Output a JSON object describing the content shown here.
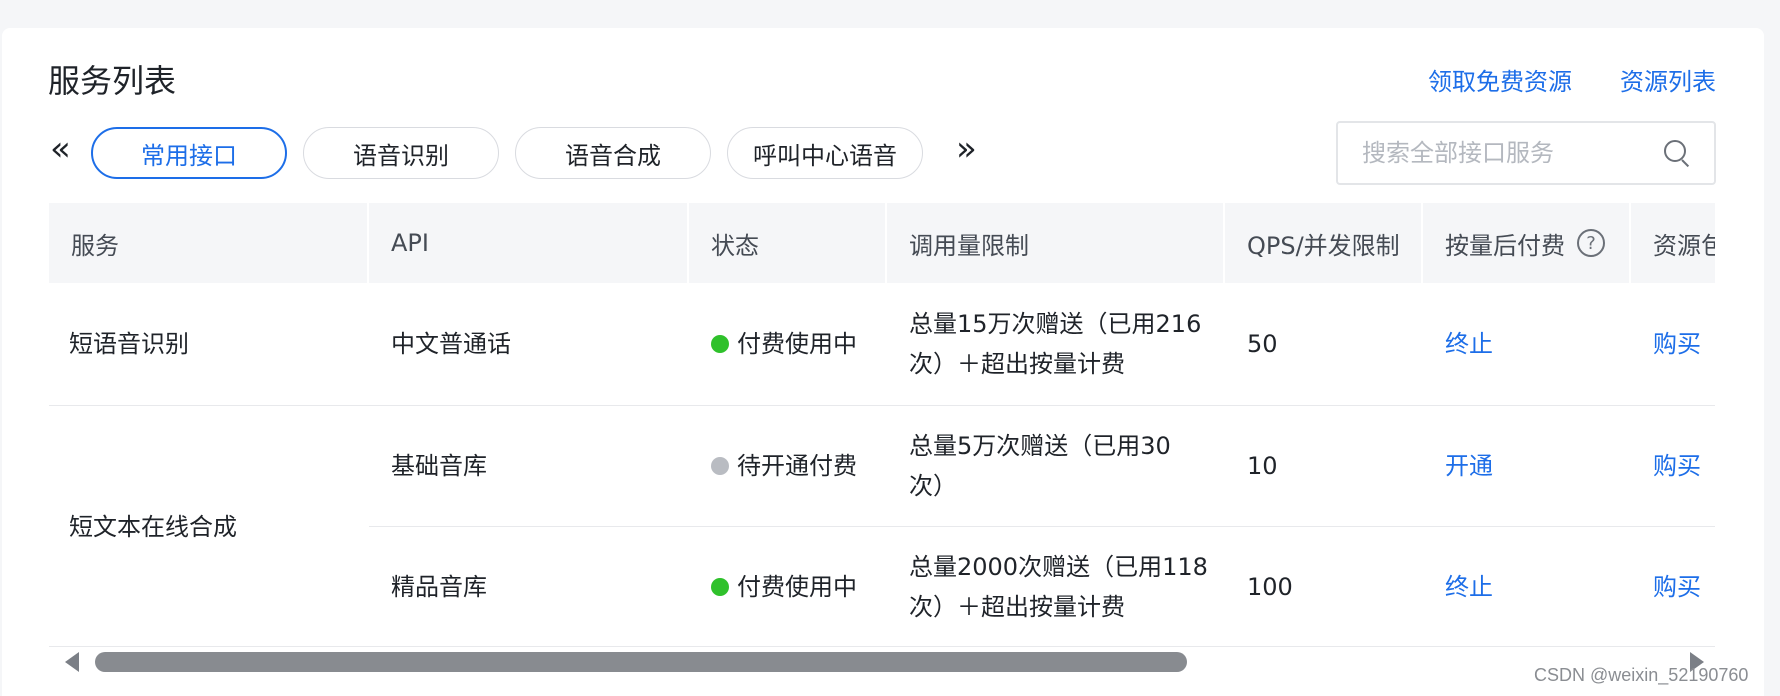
{
  "header": {
    "title": "服务列表",
    "link_free": "领取免费资源",
    "link_resources": "资源列表"
  },
  "nav": {
    "prev_arrow": "«",
    "next_arrow": "»"
  },
  "tabs": [
    {
      "label": "常用接口",
      "active": true
    },
    {
      "label": "语音识别",
      "active": false
    },
    {
      "label": "语音合成",
      "active": false
    },
    {
      "label": "呼叫中心语音",
      "active": false
    }
  ],
  "search": {
    "placeholder": "搜索全部接口服务",
    "value": ""
  },
  "table": {
    "columns": [
      "服务",
      "API",
      "状态",
      "调用量限制",
      "QPS/并发限制",
      "按量后付费",
      "资源包"
    ],
    "help_icon": "?",
    "groups": [
      {
        "service": "短语音识别"
      },
      {
        "service": "短文本在线合成"
      }
    ],
    "rows": [
      {
        "api": "中文普通话",
        "status": "付费使用中",
        "status_color": "#2fc12b",
        "limit_line1": "总量15万次赠送（已用216",
        "limit_line2": "次）＋超出按量计费",
        "qps": "50",
        "postpaid": "终止",
        "package": "购买"
      },
      {
        "api": "基础音库",
        "status": "待开通付费",
        "status_color": "#b9bcc2",
        "limit_line1": "总量5万次赠送（已用30",
        "limit_line2": "次）",
        "qps": "10",
        "postpaid": "开通",
        "package": "购买"
      },
      {
        "api": "精品音库",
        "status": "付费使用中",
        "status_color": "#2fc12b",
        "limit_line1": "总量2000次赠送（已用118",
        "limit_line2": "次）＋超出按量计费",
        "qps": "100",
        "postpaid": "终止",
        "package": "购买"
      }
    ]
  },
  "watermark": "CSDN @weixin_52190760"
}
